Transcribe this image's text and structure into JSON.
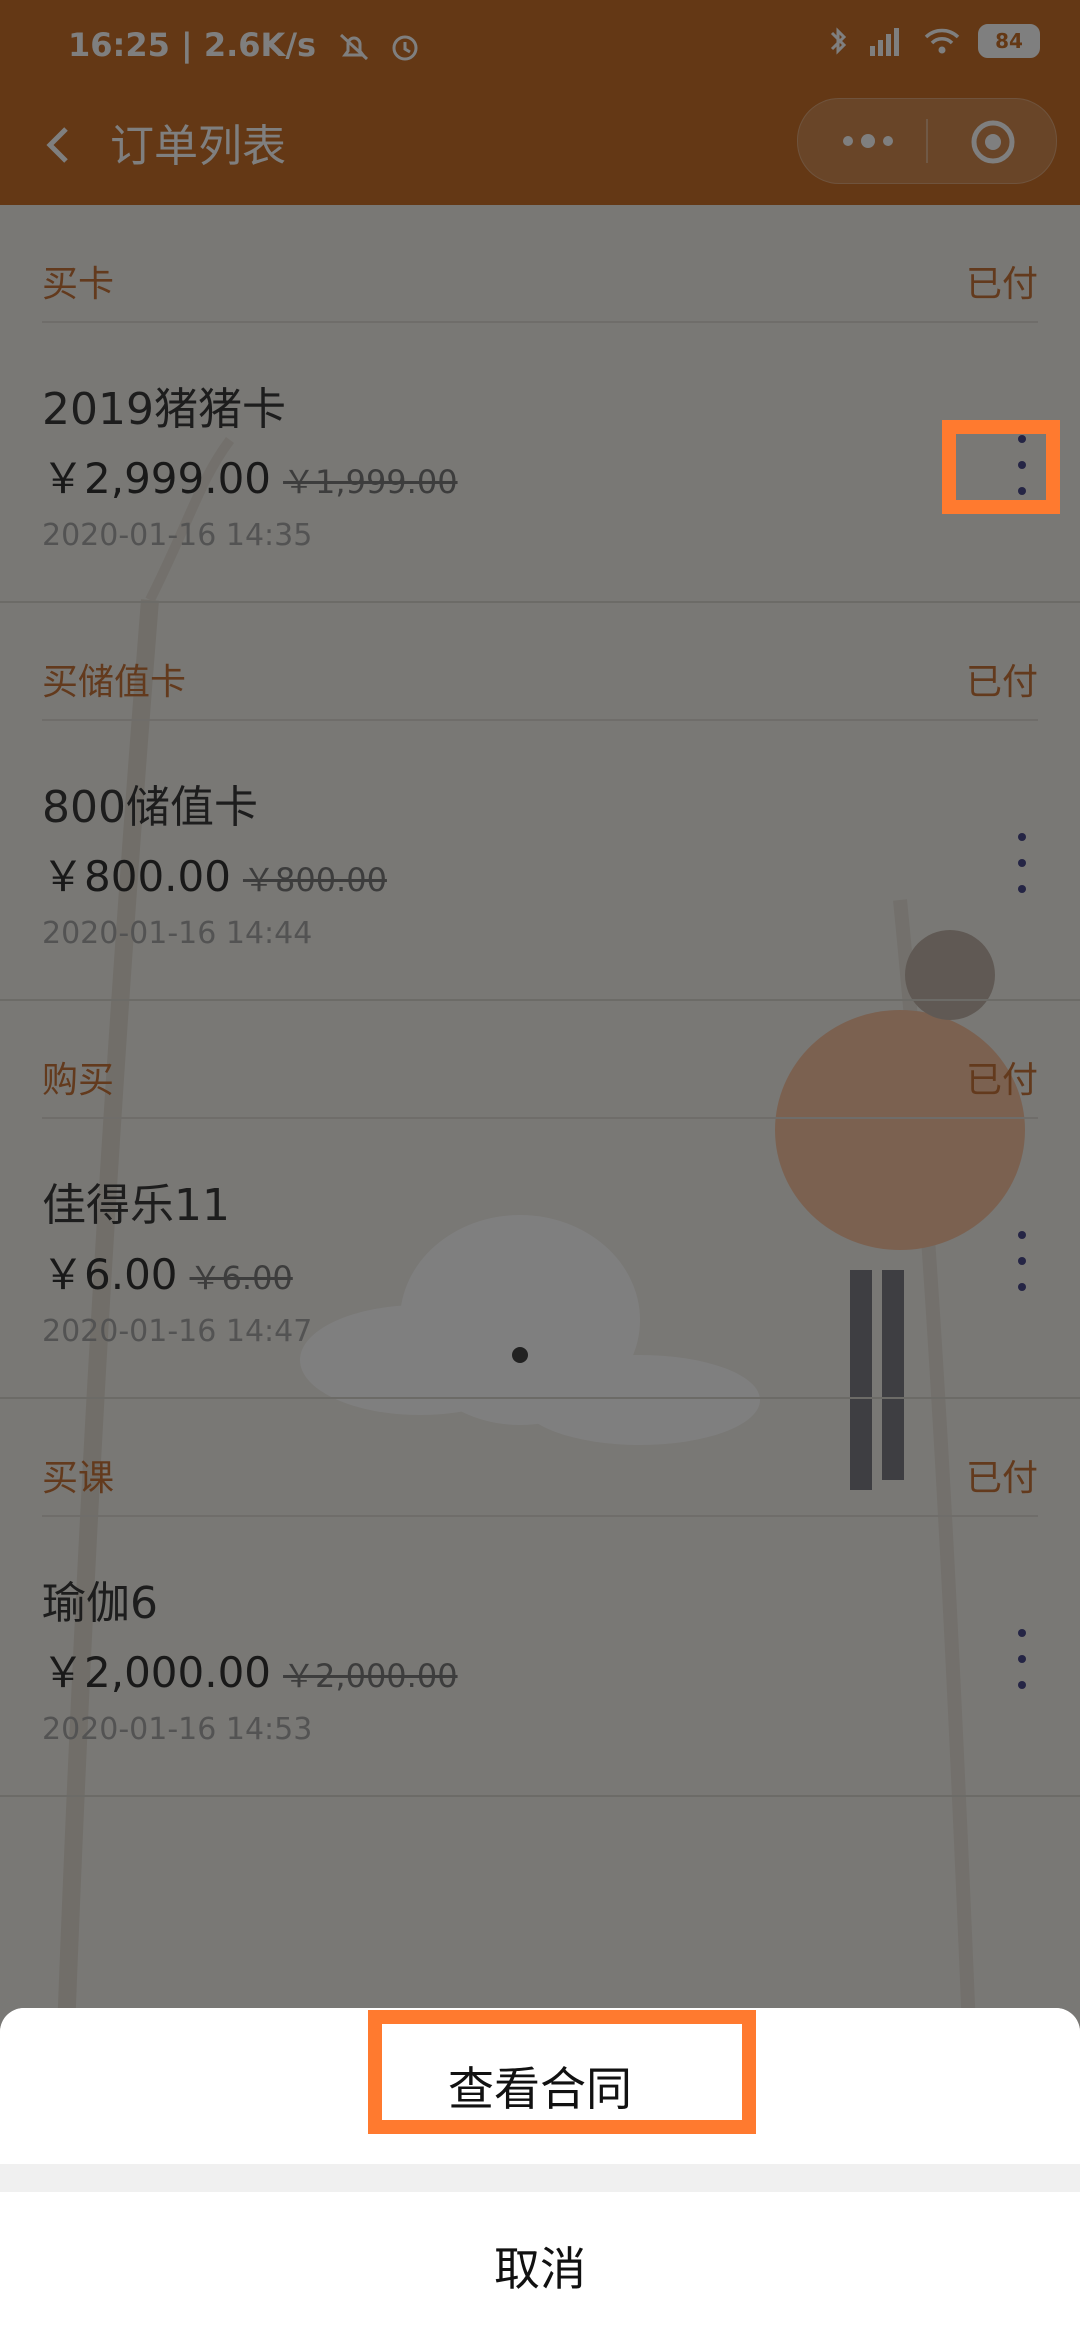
{
  "status_bar": {
    "time": "16:25",
    "network_speed": "2.6K/s",
    "battery": "84",
    "icons": [
      "bell-off-icon",
      "alarm-icon",
      "bluetooth-icon",
      "hd-signal-icon",
      "wifi-icon",
      "battery-icon"
    ]
  },
  "nav": {
    "title": "订单列表",
    "back_icon": "chevron-left-icon",
    "more_icon": "more-dots-icon",
    "close_icon": "target-icon"
  },
  "orders": [
    {
      "type": "买卡",
      "status": "已付",
      "name": "2019猪猪卡",
      "price": "￥2,999.00",
      "original_price": "￥1,999.00",
      "time": "2020-01-16 14:35"
    },
    {
      "type": "买储值卡",
      "status": "已付",
      "name": "800储值卡",
      "price": "￥800.00",
      "original_price": "￥800.00",
      "time": "2020-01-16 14:44"
    },
    {
      "type": "购买",
      "status": "已付",
      "name": "佳得乐11",
      "price": "￥6.00",
      "original_price": "￥6.00",
      "time": "2020-01-16 14:47"
    },
    {
      "type": "买课",
      "status": "已付",
      "name": "瑜伽6",
      "price": "￥2,000.00",
      "original_price": "￥2,000.00",
      "time": "2020-01-16 14:53"
    }
  ],
  "action_sheet": {
    "action_label": "查看合同",
    "cancel_label": "取消"
  },
  "colors": {
    "header": "#c9712a",
    "accent_text": "#c7753a",
    "highlight": "#ff7a2f"
  }
}
